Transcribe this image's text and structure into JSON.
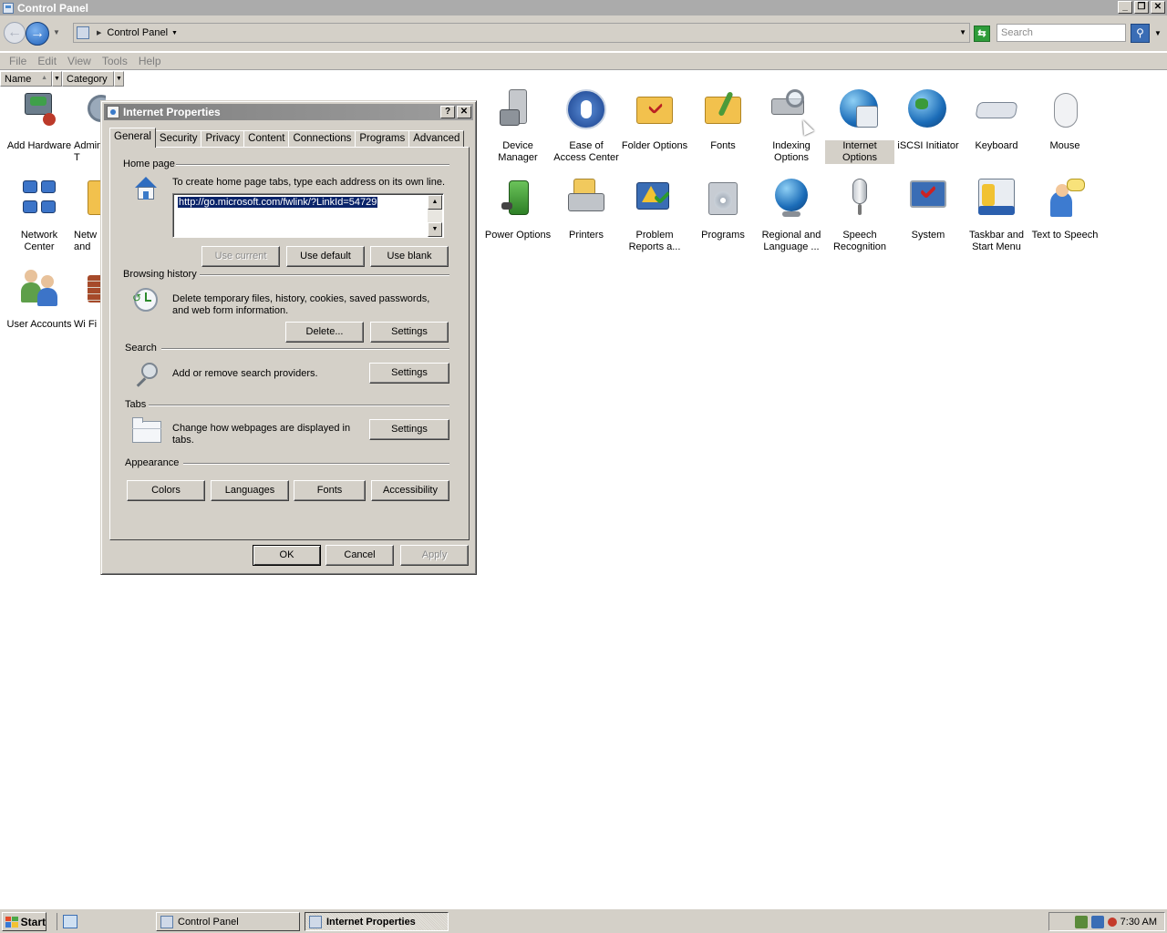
{
  "window": {
    "title": "Control Panel"
  },
  "address": {
    "crumb": "Control Panel",
    "search_placeholder": "Search"
  },
  "menu": [
    "File",
    "Edit",
    "View",
    "Tools",
    "Help"
  ],
  "columns": {
    "name": "Name",
    "category": "Category"
  },
  "items": {
    "add_hardware": "Add Hardware",
    "admin_tools": "Admini T",
    "network_center": "Network Center",
    "network_and": "Netw and",
    "user_accounts": "User Accounts",
    "windows_firewall": "Wi Fi",
    "device_manager": "Device Manager",
    "ease_of_access": "Ease of Access Center",
    "folder_options": "Folder Options",
    "fonts": "Fonts",
    "indexing_options": "Indexing Options",
    "internet_options": "Internet Options",
    "iscsi": "iSCSI Initiator",
    "keyboard": "Keyboard",
    "mouse": "Mouse",
    "power_options": "Power Options",
    "printers": "Printers",
    "problem_reports": "Problem Reports a...",
    "programs": "Programs",
    "regional": "Regional and Language ...",
    "speech": "Speech Recognition",
    "system": "System",
    "taskbar": "Taskbar and Start Menu",
    "tts": "Text to Speech"
  },
  "dialog": {
    "title": "Internet Properties",
    "help_btn": "?",
    "close_btn": "✕",
    "tabs": [
      "General",
      "Security",
      "Privacy",
      "Content",
      "Connections",
      "Programs",
      "Advanced"
    ],
    "homepage": {
      "title": "Home page",
      "desc": "To create home page tabs, type each address on its own line.",
      "url": "http://go.microsoft.com/fwlink/?LinkId=54729",
      "use_current": "Use current",
      "use_default": "Use default",
      "use_blank": "Use blank"
    },
    "history": {
      "title": "Browsing history",
      "desc1": "Delete temporary files, history, cookies, saved passwords,",
      "desc2": "and web form information.",
      "delete": "Delete...",
      "settings": "Settings"
    },
    "search": {
      "title": "Search",
      "desc": "Add or remove search providers.",
      "settings": "Settings"
    },
    "tabsgroup": {
      "title": "Tabs",
      "desc1": "Change how webpages are displayed in",
      "desc2": "tabs.",
      "settings": "Settings"
    },
    "appearance": {
      "title": "Appearance",
      "colors": "Colors",
      "languages": "Languages",
      "fonts": "Fonts",
      "accessibility": "Accessibility"
    },
    "ok": "OK",
    "cancel": "Cancel",
    "apply": "Apply"
  },
  "taskbar": {
    "start": "Start",
    "items": [
      "Control Panel",
      "Internet Properties"
    ],
    "clock": "7:30 AM"
  }
}
